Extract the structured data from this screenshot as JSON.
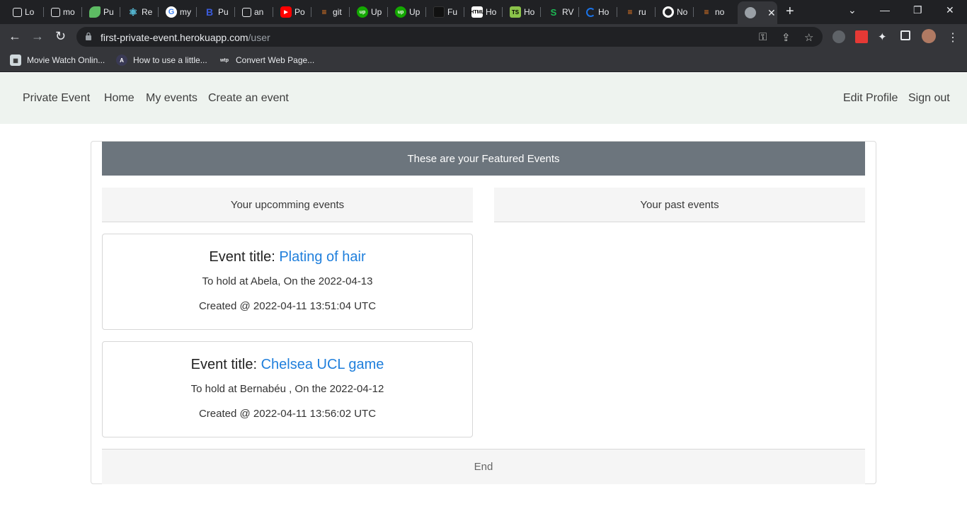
{
  "browser": {
    "tabs": [
      {
        "label": "Lo",
        "icon": "notion-icon"
      },
      {
        "label": "mo",
        "icon": "notion-icon"
      },
      {
        "label": "Pu",
        "icon": "leaf-icon"
      },
      {
        "label": "Re",
        "icon": "react-icon"
      },
      {
        "label": "my",
        "icon": "google-icon"
      },
      {
        "label": "Pu",
        "icon": "bold-b-icon"
      },
      {
        "label": "an",
        "icon": "notion-icon"
      },
      {
        "label": "Po",
        "icon": "youtube-icon"
      },
      {
        "label": "git",
        "icon": "stackoverflow-icon"
      },
      {
        "label": "Up",
        "icon": "upwork-icon"
      },
      {
        "label": "Up",
        "icon": "upwork-icon"
      },
      {
        "label": "Fu",
        "icon": "blank-icon"
      },
      {
        "label": "Ho",
        "icon": "html-icon"
      },
      {
        "label": "Ho",
        "icon": "typescript-icon"
      },
      {
        "label": "RV",
        "icon": "scribd-icon"
      },
      {
        "label": "Ho",
        "icon": "loader-icon"
      },
      {
        "label": "ru",
        "icon": "stackoverflow-icon"
      },
      {
        "label": "No",
        "icon": "github-icon"
      },
      {
        "label": "no",
        "icon": "stackoverflow-icon"
      }
    ],
    "active_tab_icon": "globe-icon",
    "url_host": "first-private-event.herokuapp.com",
    "url_path": "/user",
    "bookmarks": [
      {
        "label": "Movie Watch Onlin...",
        "icon": "movie-icon"
      },
      {
        "label": "How to use a little...",
        "icon": "laravel-icon"
      },
      {
        "label": "Convert Web Page...",
        "icon": "wtp-icon"
      }
    ]
  },
  "navbar": {
    "brand": "Private Event",
    "links": [
      "Home",
      "My events",
      "Create an event"
    ],
    "right_links": [
      "Edit Profile",
      "Sign out"
    ]
  },
  "main": {
    "featured_title": "These are your Featured Events",
    "upcoming_header": "Your upcomming events",
    "past_header": "Your past events",
    "events": [
      {
        "title_prefix": "Event title: ",
        "name": "Plating of hair",
        "location_line": "To hold at Abela, On the 2022-04-13",
        "created_line": "Created @ 2022-04-11 13:51:04 UTC"
      },
      {
        "title_prefix": "Event title: ",
        "name": "Chelsea UCL game",
        "location_line": "To hold at Bernabéu , On the 2022-04-12",
        "created_line": "Created @ 2022-04-11 13:56:02 UTC"
      }
    ],
    "footer": "End"
  },
  "colors": {
    "featured_bg": "#6c757d",
    "link_blue": "#1f7fdc",
    "navbar_bg": "#eef3ef"
  }
}
